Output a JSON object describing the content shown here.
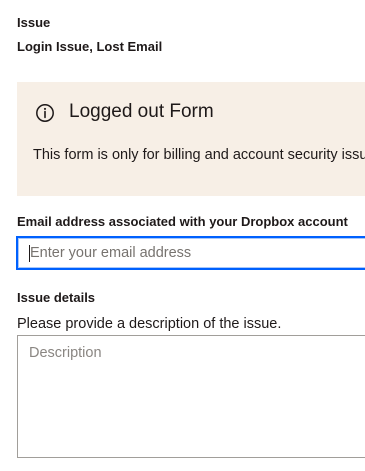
{
  "issue": {
    "label": "Issue",
    "value": "Login Issue, Lost Email"
  },
  "notice": {
    "icon": "info-icon",
    "title": "Logged out Form",
    "text": "This form is only for billing and account security issues."
  },
  "email": {
    "label": "Email address associated with your Dropbox account",
    "value": "",
    "placeholder": "Enter your email address"
  },
  "details": {
    "label": "Issue details",
    "help": "Please provide a description of the issue.",
    "value": "",
    "placeholder": "Description"
  },
  "colors": {
    "notice_bg": "#f7efe6",
    "focus_border": "#0061fe",
    "text": "#1e1919"
  }
}
